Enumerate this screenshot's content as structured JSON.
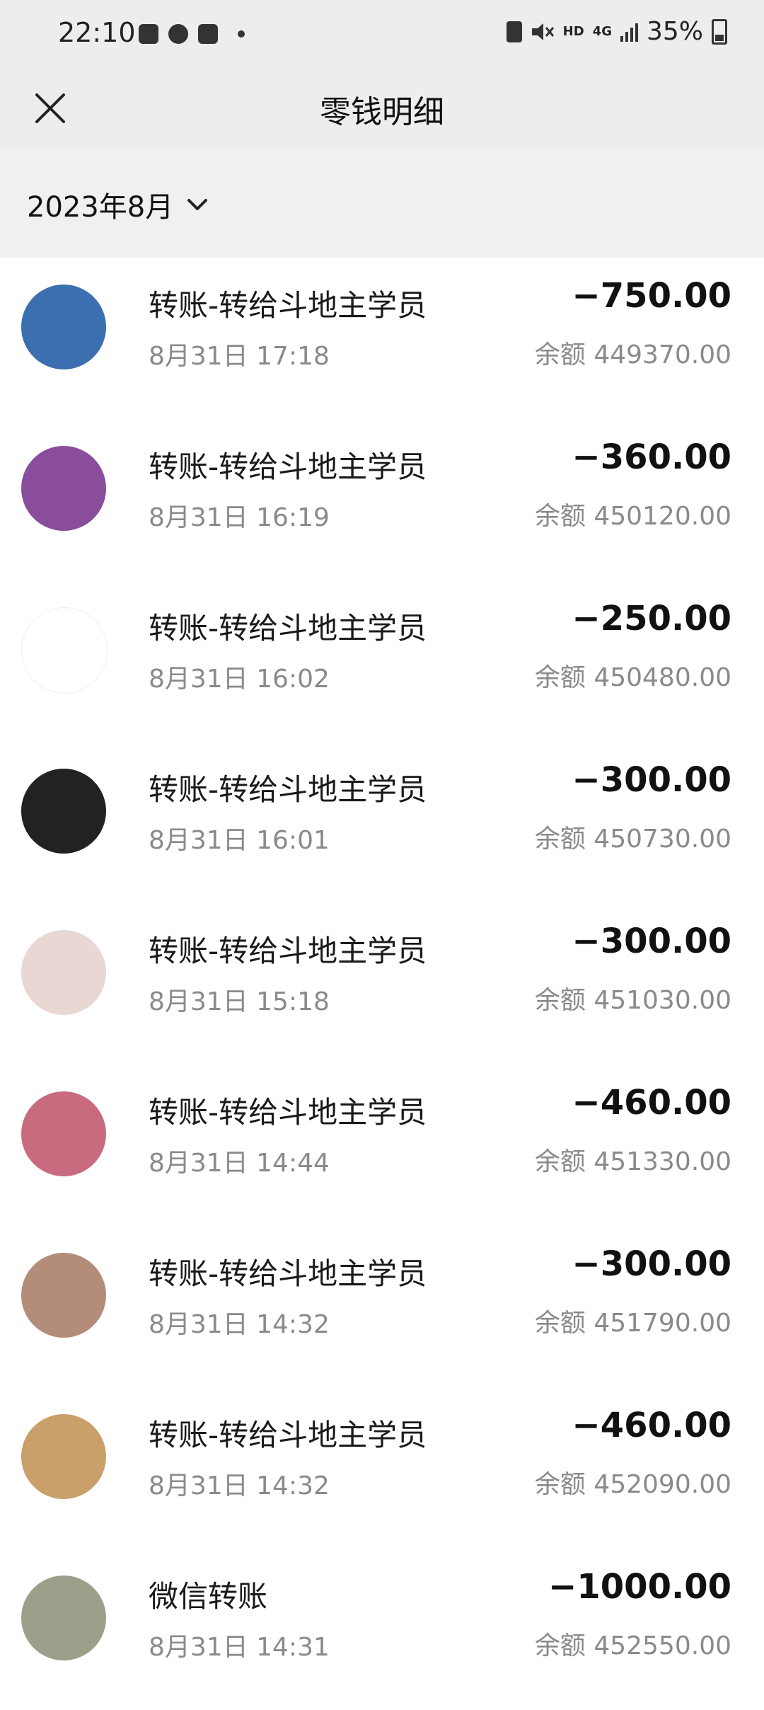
{
  "status_bar": {
    "time": "22:10",
    "network": "HD",
    "network_type": "4G",
    "battery": "35%",
    "left_icons": [
      "gallery-icon",
      "vpn-icon",
      "checkbox-icon"
    ],
    "right_icons": [
      "recycle-icon",
      "mute-icon",
      "signal-icon",
      "battery-icon"
    ]
  },
  "nav": {
    "title": "零钱明细",
    "close_icon": "close-icon"
  },
  "filter": {
    "month": "2023年8月",
    "icon": "chevron-down-icon"
  },
  "transactions": [
    {
      "title": "转账-转给斗地主学员",
      "time": "8月31日 17:18",
      "amount": "−750.00",
      "balance": "余额 449370.00",
      "avatar_color": "#3b6fb0"
    },
    {
      "title": "转账-转给斗地主学员",
      "time": "8月31日 16:19",
      "amount": "−360.00",
      "balance": "余额 450120.00",
      "avatar_color": "#8a4d9c"
    },
    {
      "title": "转账-转给斗地主学员",
      "time": "8月31日 16:02",
      "amount": "−250.00",
      "balance": "余额 450480.00",
      "avatar_color": "#ffffff"
    },
    {
      "title": "转账-转给斗地主学员",
      "time": "8月31日 16:01",
      "amount": "−300.00",
      "balance": "余额 450730.00",
      "avatar_color": "#222222"
    },
    {
      "title": "转账-转给斗地主学员",
      "time": "8月31日 15:18",
      "amount": "−300.00",
      "balance": "余额 451030.00",
      "avatar_color": "#e8d7d3"
    },
    {
      "title": "转账-转给斗地主学员",
      "time": "8月31日 14:44",
      "amount": "−460.00",
      "balance": "余额 451330.00",
      "avatar_color": "#c96b7e"
    },
    {
      "title": "转账-转给斗地主学员",
      "time": "8月31日 14:32",
      "amount": "−300.00",
      "balance": "余额 451790.00",
      "avatar_color": "#b38d7a"
    },
    {
      "title": "转账-转给斗地主学员",
      "time": "8月31日 14:32",
      "amount": "−460.00",
      "balance": "余额 452090.00",
      "avatar_color": "#c9a06a"
    },
    {
      "title": "微信转账",
      "time": "8月31日 14:31",
      "amount": "−1000.00",
      "balance": "余额 452550.00",
      "avatar_color": "#9aa08a"
    }
  ]
}
